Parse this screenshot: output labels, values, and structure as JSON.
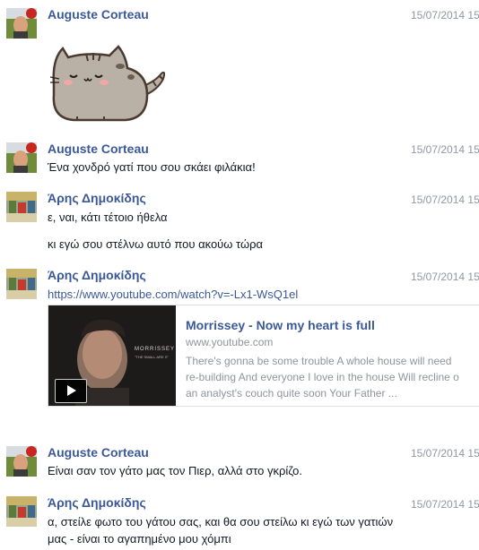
{
  "colors": {
    "name": "#3b5998",
    "timestamp": "#9197a3",
    "text": "#141823"
  },
  "messages": [
    {
      "sender": "Auguste Corteau",
      "time": "15/07/2014 15",
      "sticker": "pusheen-cat-sticker"
    },
    {
      "sender": "Auguste Corteau",
      "time": "15/07/2014 15",
      "lines": [
        "Ένα χονδρό γατί που σου σκάει φιλάκια!"
      ]
    },
    {
      "sender": "Άρης Δημοκίδης",
      "time": "15/07/2014 15",
      "lines": [
        "ε, ναι, κάτι τέτοιο ήθελα",
        "κι εγώ σου στέλνω αυτό που ακούω τώρα"
      ]
    },
    {
      "sender": "Άρης Δημοκίδης",
      "time": "15/07/2014 15",
      "link": "https://www.youtube.com/watch?v=-Lx1-WsQ1el",
      "card": {
        "title": "Morrissey - Now my heart is full",
        "domain": "www.youtube.com",
        "description": [
          "There's gonna be some trouble A whole house will need",
          "re-building And everyone I love in the house Will recline o",
          "an analyst's couch quite soon Your Father ..."
        ],
        "thumb_text": "MORRISSEY",
        "thumb_subtext": "\"THE SMALL ARE S\""
      }
    },
    {
      "sender": "Auguste Corteau",
      "time": "15/07/2014 15",
      "lines": [
        "Είναι σαν τον γάτο μας τον Πιερ, αλλά στο γκρίζο."
      ]
    },
    {
      "sender": "Άρης Δημοκίδης",
      "time": "15/07/2014 15",
      "lines": [
        "α, στείλε φωτο του γάτου σας, και θα σου στείλω κι εγώ των γατιών",
        "μας - είναι το αγαπημένο μου χόμπι"
      ]
    }
  ]
}
